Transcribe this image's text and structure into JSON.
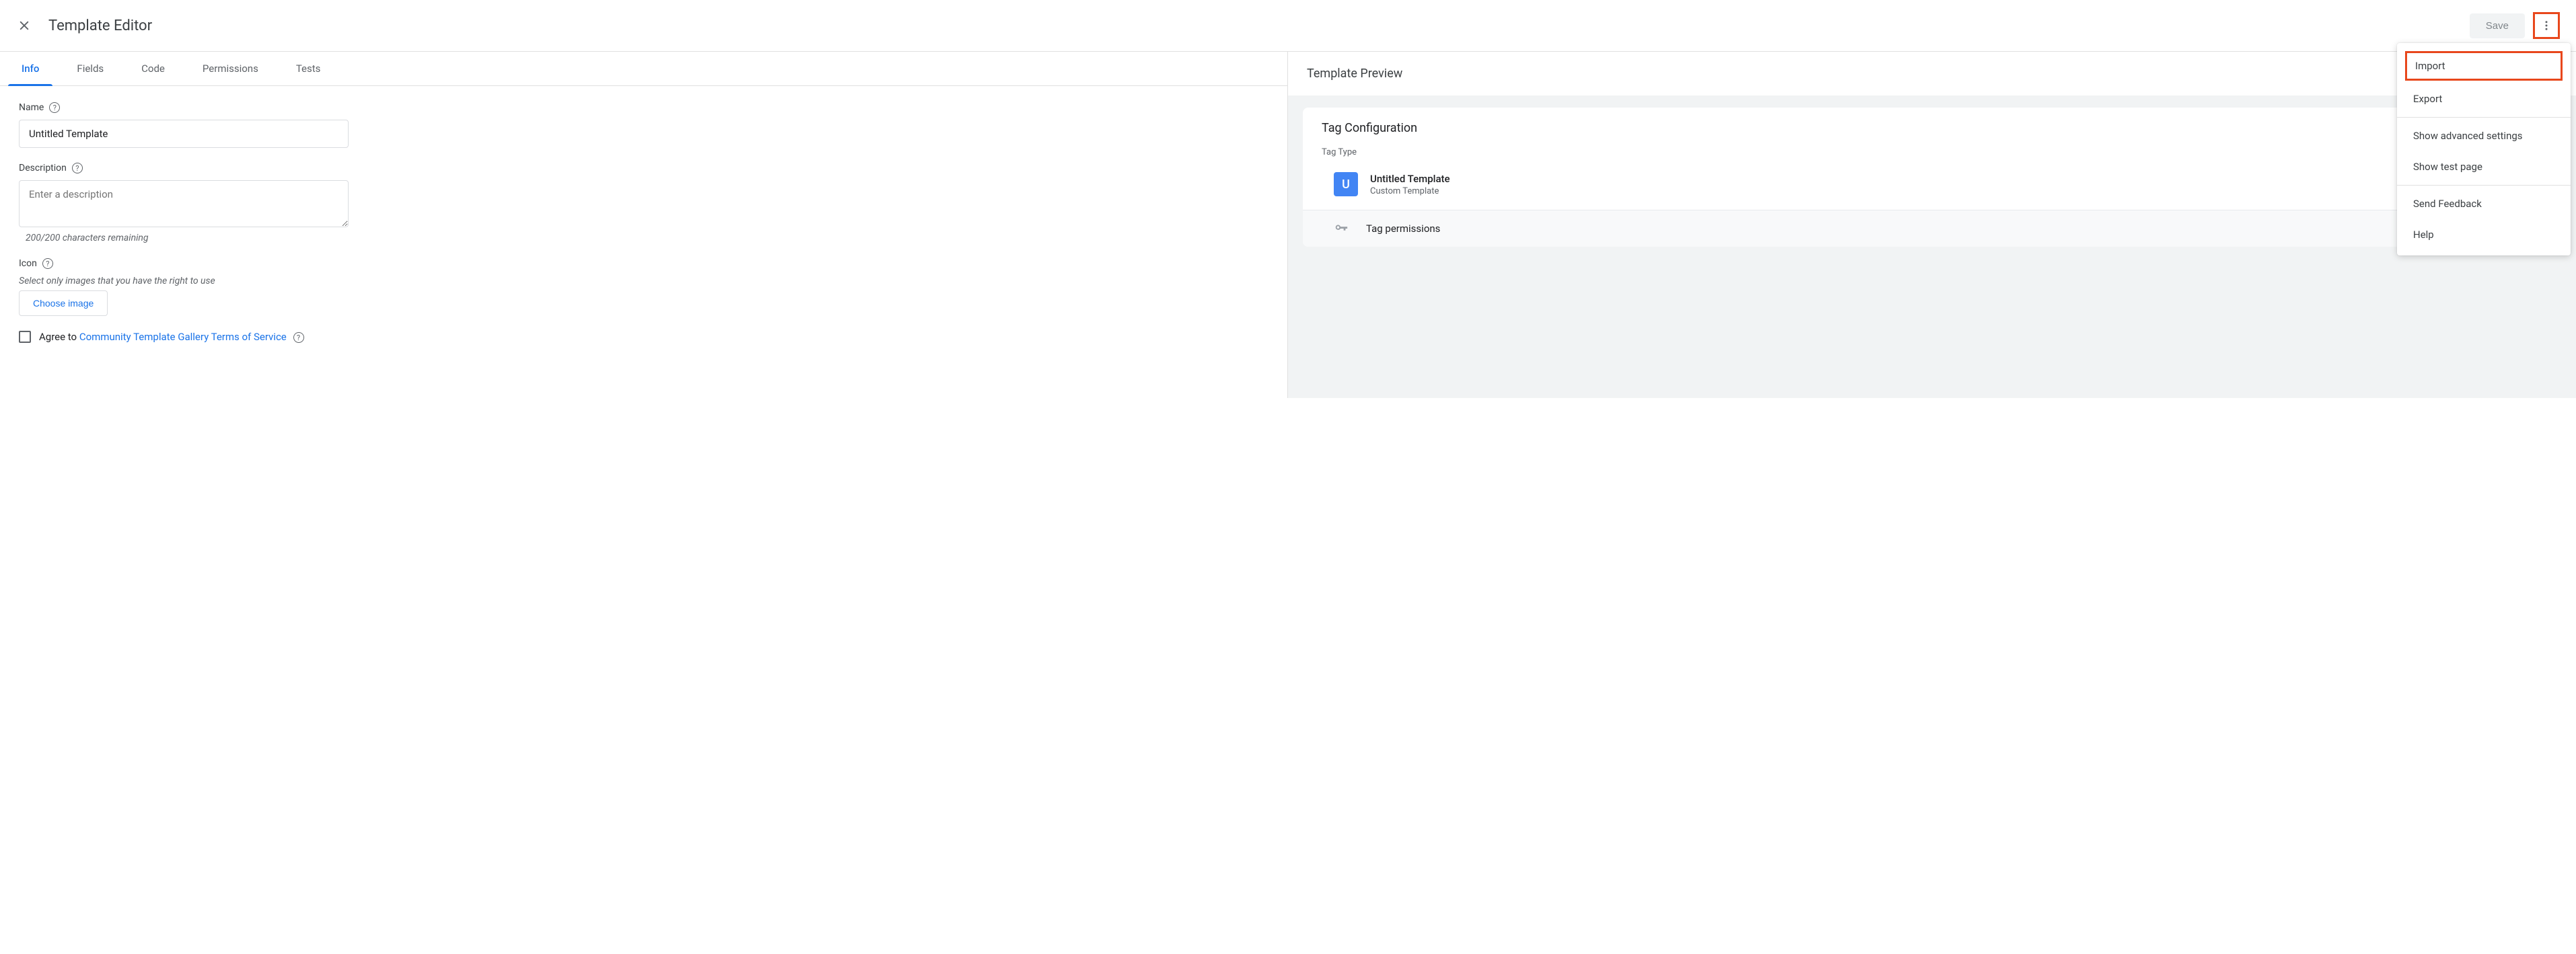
{
  "header": {
    "title": "Template Editor",
    "save_label": "Save"
  },
  "tabs": [
    "Info",
    "Fields",
    "Code",
    "Permissions",
    "Tests"
  ],
  "form": {
    "name_label": "Name",
    "name_value": "Untitled Template",
    "desc_label": "Description",
    "desc_placeholder": "Enter a description",
    "desc_helper": "200/200 characters remaining",
    "icon_label": "Icon",
    "icon_helper": "Select only images that you have the right to use",
    "choose_image_label": "Choose image",
    "agree_prefix": "Agree to ",
    "agree_link": "Community Template Gallery Terms of Service"
  },
  "preview": {
    "title": "Template Preview",
    "card_title": "Tag Configuration",
    "tag_type_label": "Tag Type",
    "tag_letter": "U",
    "tag_name": "Untitled Template",
    "tag_sub": "Custom Template",
    "permissions_label": "Tag permissions"
  },
  "menu": {
    "import": "Import",
    "export": "Export",
    "advanced": "Show advanced settings",
    "test_page": "Show test page",
    "feedback": "Send Feedback",
    "help": "Help"
  }
}
